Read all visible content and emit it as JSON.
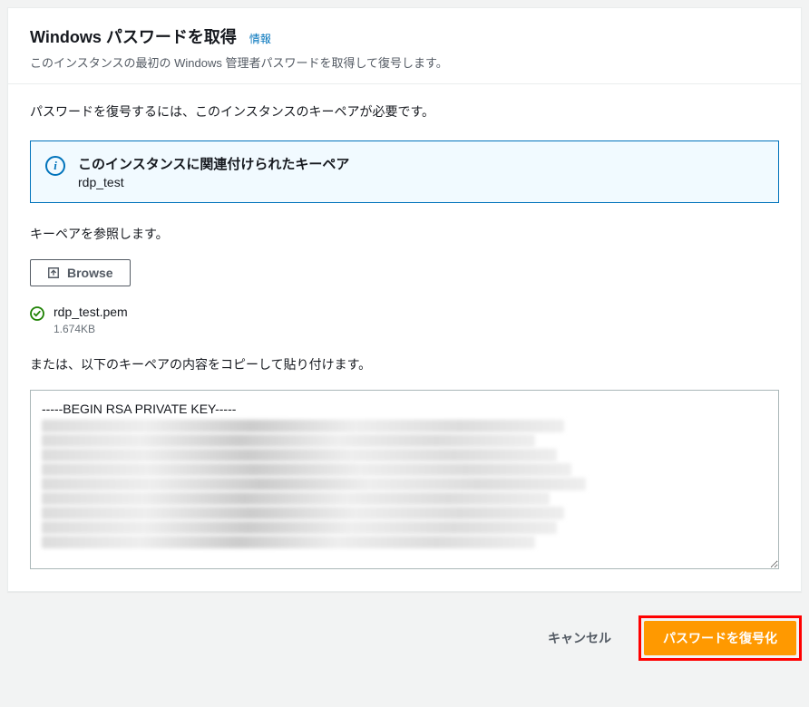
{
  "header": {
    "title": "Windows パスワードを取得",
    "info_link": "情報",
    "subtitle": "このインスタンスの最初の Windows 管理者パスワードを取得して復号します。"
  },
  "body": {
    "intro": "パスワードを復号するには、このインスタンスのキーペアが必要です。",
    "info_box": {
      "title": "このインスタンスに関連付けられたキーペア",
      "value": "rdp_test"
    },
    "browse_label": "キーペアを参照します。",
    "browse_button": "Browse",
    "uploaded_file": {
      "name": "rdp_test.pem",
      "size": "1.674KB"
    },
    "or_text": "または、以下のキーペアの内容をコピーして貼り付けます。",
    "textarea_first_line": "-----BEGIN RSA PRIVATE KEY-----"
  },
  "footer": {
    "cancel": "キャンセル",
    "decrypt": "パスワードを復号化"
  }
}
